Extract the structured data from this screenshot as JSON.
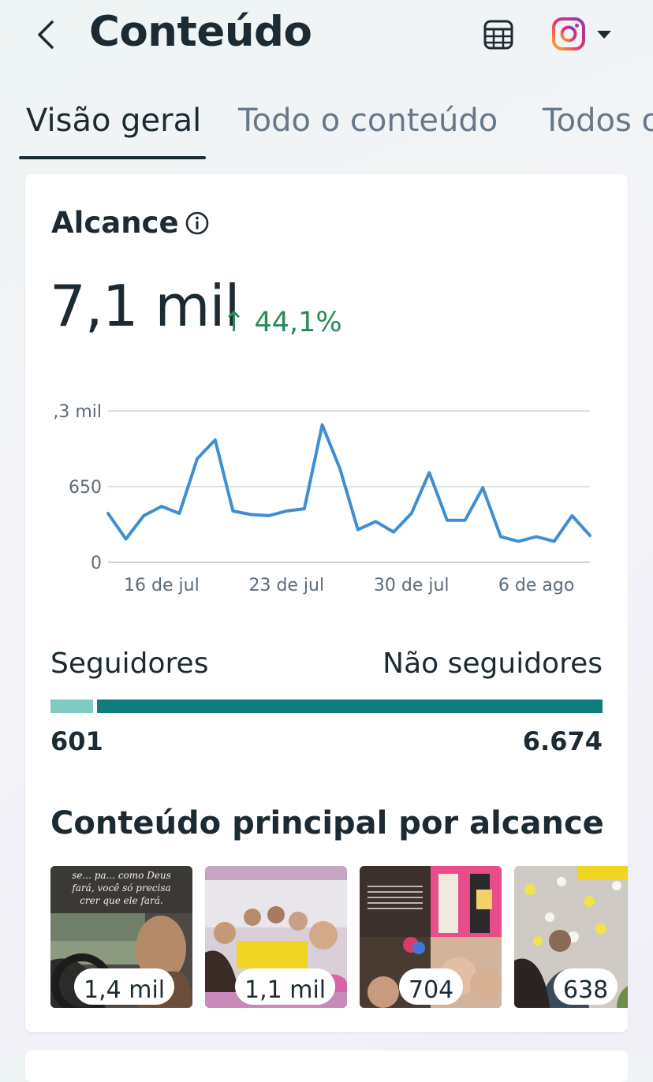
{
  "header": {
    "title": "Conteúdo",
    "back_icon": "chevron-left-icon",
    "calendar_icon": "calendar-grid-icon",
    "account_icon": "instagram-icon",
    "dropdown_icon": "caret-down-icon"
  },
  "tabs": [
    {
      "label": "Visão geral",
      "active": true
    },
    {
      "label": "Todo o conteúdo",
      "active": false
    },
    {
      "label": "Todos os",
      "active": false
    }
  ],
  "reach": {
    "title": "Alcance",
    "info_icon": "info-icon",
    "value": "7,1 mil",
    "change_arrow": "↑",
    "change": "44,1%",
    "change_color": "#2a8a5a"
  },
  "chart_data": {
    "type": "line",
    "y_tick_labels": [
      "0",
      "650",
      ",3 mil"
    ],
    "y_ticks": [
      0,
      650,
      1300
    ],
    "ylim": [
      0,
      1300
    ],
    "x_tick_labels": [
      "16 de jul",
      "23 de jul",
      "30 de jul",
      "6 de ago"
    ],
    "x_tick_days": [
      3,
      10,
      17,
      24
    ],
    "xlabel": "",
    "ylabel": "",
    "grid": true,
    "series": [
      {
        "color": "#3f8ed1",
        "days": [
          0,
          1,
          2,
          3,
          4,
          5,
          6,
          7,
          8,
          9,
          10,
          11,
          12,
          13,
          14,
          15,
          16,
          17,
          18,
          19,
          20,
          21,
          22,
          23,
          24,
          25,
          26,
          27
        ],
        "values": [
          420,
          200,
          400,
          480,
          420,
          890,
          1050,
          440,
          410,
          400,
          440,
          460,
          1180,
          800,
          280,
          350,
          260,
          420,
          770,
          360,
          360,
          640,
          220,
          180,
          220,
          180,
          400,
          230
        ]
      }
    ]
  },
  "audience": {
    "followers_label": "Seguidores",
    "non_followers_label": "Não seguidores",
    "followers_count": "601",
    "non_followers_count": "6.674",
    "followers_fraction": 0.0826,
    "followers_color": "#7fcac2",
    "non_followers_color": "#0f7d7b"
  },
  "top_content": {
    "title": "Conteúdo principal por alcance",
    "items": [
      {
        "reach": "1,4 mil",
        "overlay_text": "se... pa... como Deus fará, você só precisa crer que ele fará."
      },
      {
        "reach": "1,1 mil"
      },
      {
        "reach": "704"
      },
      {
        "reach": "638"
      }
    ]
  }
}
